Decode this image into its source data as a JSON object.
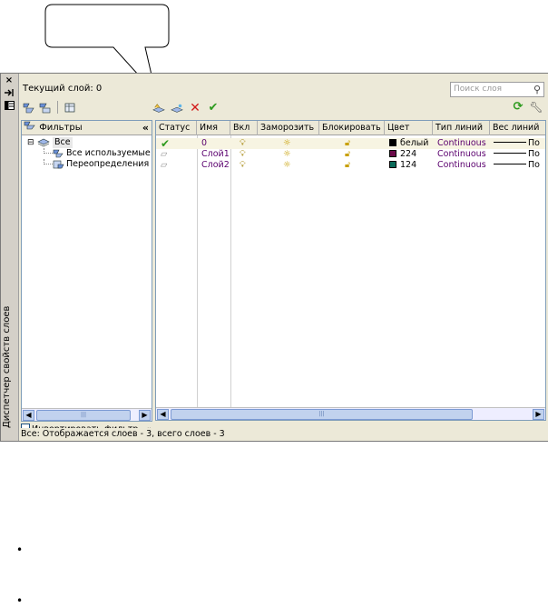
{
  "window": {
    "side_title": "Диспетчер свойств слоев",
    "close_glyph": "×",
    "current_layer_label": "Текущий слой: 0",
    "search_placeholder": "Поиск слоя",
    "status_text": "Все: Отображается слоев - 3, всего слоев - 3"
  },
  "icons": {
    "close": "close-icon",
    "autohide": "autohide-icon",
    "properties": "properties-icon",
    "new_filter": "new-property-filter-icon",
    "new_group_filter": "new-group-filter-icon",
    "states": "layer-states-manager-icon",
    "new_layer": "new-layer-icon",
    "new_layer_frozen": "new-layer-vp-frozen-icon",
    "delete_layer": "delete-layer-icon",
    "set_current": "set-current-icon",
    "refresh": "refresh-icon",
    "settings": "settings-icon"
  },
  "filters": {
    "header": "Фильтры",
    "collapse_glyph": "«",
    "tree": [
      {
        "label": "Все",
        "expander": "⊟"
      },
      {
        "label": "Все используемые"
      },
      {
        "label": "Переопределения"
      }
    ],
    "invert_label": "Инвертировать фильтр"
  },
  "layers": {
    "columns": [
      "Статус",
      "Имя",
      "Вкл",
      "Заморозить",
      "Блокировать",
      "Цвет",
      "Тип линий",
      "Вес линий"
    ],
    "rows": [
      {
        "name": "0",
        "color_name": "белый",
        "color_hex": "#000000",
        "linetype": "Continuous",
        "lineweight": "По",
        "current": true
      },
      {
        "name": "Слой1",
        "color_name": "224",
        "color_hex": "#6b0a4a",
        "linetype": "Continuous",
        "lineweight": "По",
        "current": false
      },
      {
        "name": "Слой2",
        "color_name": "124",
        "color_hex": "#0a6b5a",
        "linetype": "Continuous",
        "lineweight": "По",
        "current": false
      }
    ]
  },
  "colors": {
    "linetype_text": "#5a006e",
    "name_text": "#5a006e"
  },
  "bullets": [
    "•",
    "•"
  ]
}
